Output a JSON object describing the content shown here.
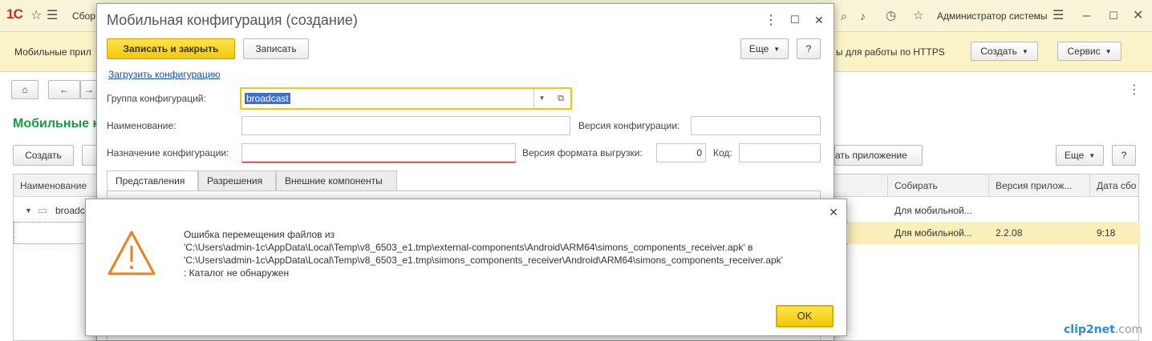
{
  "app": {
    "title": "Сбор",
    "user": "Администратор системы",
    "toolbar_left_label": "Мобильные прил",
    "https_label": "ы для работы по HTTPS",
    "create_btn": "Создать",
    "service_btn": "Сервис",
    "list_title": "Мобильные к",
    "list_create_btn": "Создать",
    "list_app_btn": "ать приложение",
    "list_more_btn": "Еще",
    "help_btn": "?",
    "grid": {
      "columns": [
        "Наименование",
        "Собирать",
        "Версия прилож...",
        "Дата сбо"
      ],
      "rows": [
        {
          "name": "broadc",
          "build": "Для мобильной...",
          "version": "",
          "date": ""
        },
        {
          "name": "",
          "build": "Для мобильной...",
          "version": "2.2.08",
          "date": "9:18"
        }
      ]
    }
  },
  "dialog": {
    "title": "Мобильная конфигурация (создание)",
    "save_close_btn": "Записать и закрыть",
    "save_btn": "Записать",
    "more_btn": "Еще",
    "help_btn": "?",
    "load_link": "Загрузить конфигурацию",
    "group_label": "Группа конфигураций:",
    "group_value": "broadcast",
    "name_label": "Наименование:",
    "name_value": "",
    "config_version_label": "Версия конфигурации:",
    "config_version_value": "",
    "purpose_label": "Назначение конфигурации:",
    "purpose_value": "",
    "export_version_label": "Версия формата выгрузки:",
    "export_version_value": "0",
    "code_label": "Код:",
    "code_value": "",
    "tabs": [
      "Представления",
      "Разрешения",
      "Внешние компоненты"
    ]
  },
  "message": {
    "lines": [
      "Ошибка перемещения файлов из",
      "'C:\\Users\\admin-1c\\AppData\\Local\\Temp\\v8_6503_e1.tmp\\external-components\\Android\\ARM64\\simons_components_receiver.apk' в",
      "'C:\\Users\\admin-1c\\AppData\\Local\\Temp\\v8_6503_e1.tmp\\simons_components_receiver\\Android\\ARM64\\simons_components_receiver.apk'",
      ": Каталог не обнаружен"
    ],
    "ok_btn": "OK"
  },
  "watermark": {
    "brand": "clip2net",
    "suffix": ".com"
  },
  "colors": {
    "accent_yellow": "#f2c80a",
    "title_green": "#1a9a44",
    "link_blue": "#1c4ea3",
    "warning_orange": "#e8821e"
  }
}
